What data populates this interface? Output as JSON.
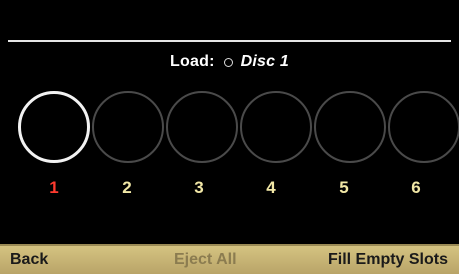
{
  "header": {
    "load_label": "Load:",
    "disc_label": "Disc 1"
  },
  "slots": [
    {
      "number": "1",
      "selected": true
    },
    {
      "number": "2",
      "selected": false
    },
    {
      "number": "3",
      "selected": false
    },
    {
      "number": "4",
      "selected": false
    },
    {
      "number": "5",
      "selected": false
    },
    {
      "number": "6",
      "selected": false
    }
  ],
  "softkeys": {
    "back": "Back",
    "eject_all": "Eject All",
    "fill_empty_slots": "Fill Empty Slots"
  },
  "colors": {
    "background": "#000000",
    "softkey_bar": "#c9b878",
    "selected_number": "#ff3b2f",
    "slot_number": "#f1e7a6",
    "disabled_softkey": "#8b7c50"
  }
}
